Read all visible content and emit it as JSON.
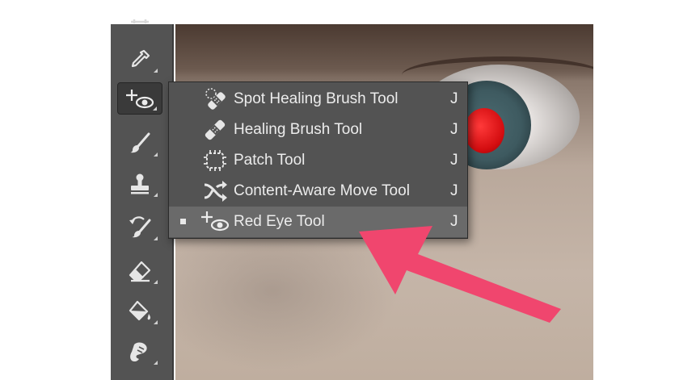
{
  "toolbar": {
    "tools": [
      {
        "name": "crop-tool-partial",
        "icon": "crop-icon"
      },
      {
        "name": "eyedropper-tool",
        "icon": "eyedropper-icon"
      },
      {
        "name": "healing-tools",
        "icon": "red-eye-icon",
        "active": true
      },
      {
        "name": "brush-tool",
        "icon": "brush-icon"
      },
      {
        "name": "clone-stamp-tool",
        "icon": "stamp-icon"
      },
      {
        "name": "history-brush-tool",
        "icon": "history-brush-icon"
      },
      {
        "name": "eraser-tool",
        "icon": "eraser-icon"
      },
      {
        "name": "paint-bucket-tool",
        "icon": "paint-bucket-icon"
      },
      {
        "name": "smudge-tool",
        "icon": "smudge-icon"
      }
    ]
  },
  "flyout": {
    "items": [
      {
        "label": "Spot Healing Brush Tool",
        "shortcut": "J",
        "icon": "spot-healing-brush-icon",
        "selected": false
      },
      {
        "label": "Healing Brush Tool",
        "shortcut": "J",
        "icon": "healing-brush-icon",
        "selected": false
      },
      {
        "label": "Patch Tool",
        "shortcut": "J",
        "icon": "patch-icon",
        "selected": false
      },
      {
        "label": "Content-Aware Move Tool",
        "shortcut": "J",
        "icon": "content-aware-move-icon",
        "selected": false
      },
      {
        "label": "Red Eye Tool",
        "shortcut": "J",
        "icon": "red-eye-icon",
        "selected": true
      }
    ]
  },
  "colors": {
    "panel": "#535353",
    "selected_row": "#6a6a6a",
    "menu_text": "#ececec",
    "annotation_arrow": "#f0466e"
  }
}
